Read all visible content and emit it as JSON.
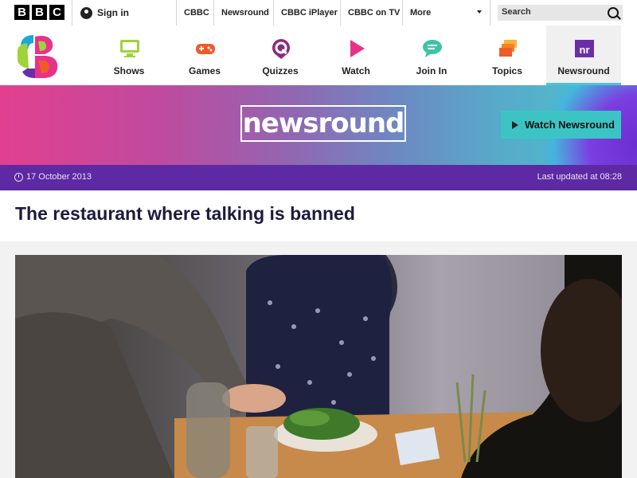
{
  "topbar": {
    "logo_letters": [
      "B",
      "B",
      "C"
    ],
    "signin_label": "Sign in",
    "links": [
      "CBBC",
      "Newsround",
      "CBBC iPlayer",
      "CBBC on TV",
      "More"
    ],
    "search_placeholder": "Search"
  },
  "cbbc_nav": {
    "items": [
      {
        "label": "Shows",
        "icon": "tv-icon",
        "color": "#9fd33a"
      },
      {
        "label": "Games",
        "icon": "gamepad-icon",
        "color": "#f05a28"
      },
      {
        "label": "Quizzes",
        "icon": "quiz-icon",
        "color": "#8a2a7e"
      },
      {
        "label": "Watch",
        "icon": "play-icon",
        "color": "#e8318a"
      },
      {
        "label": "Join In",
        "icon": "chat-icon",
        "color": "#3cc4a8"
      },
      {
        "label": "Topics",
        "icon": "layers-icon",
        "color": "#f58220"
      },
      {
        "label": "Newsround",
        "icon": "newsround-icon",
        "color": "#6a2fa8"
      }
    ],
    "active": "Newsround"
  },
  "banner": {
    "logo_text": "newsround",
    "watch_button": "Watch Newsround"
  },
  "article": {
    "date": "17 October 2013",
    "updated": "Last updated at 08:28",
    "headline": "The restaurant where talking is banned"
  }
}
